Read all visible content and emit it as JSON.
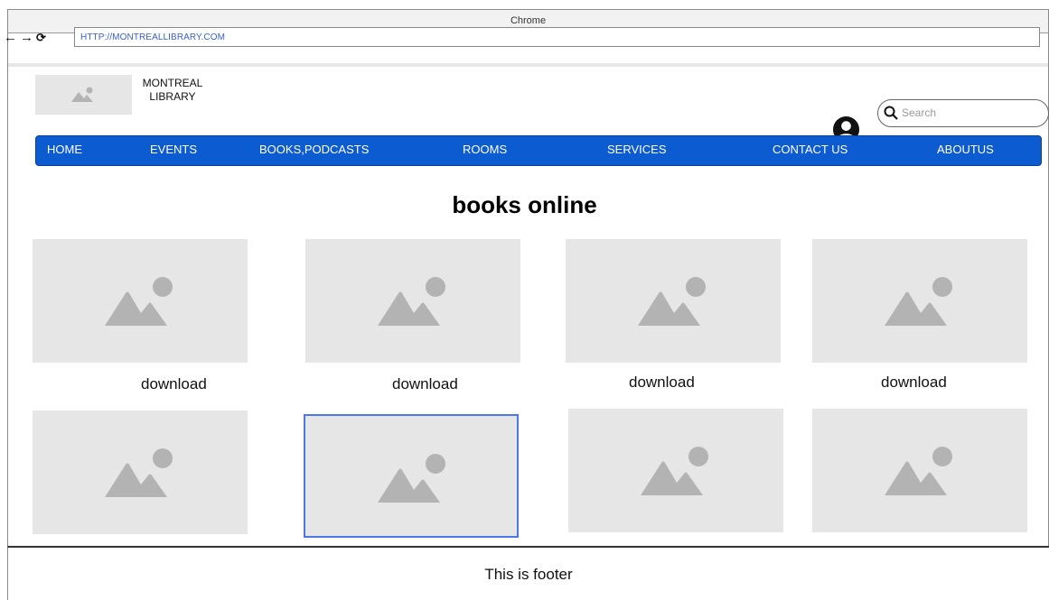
{
  "browser": {
    "title": "Chrome",
    "url": "HTTP://MONTREALLIBRARY.COM",
    "icons": [
      "back-arrow-icon",
      "forward-arrow-icon",
      "reload-icon"
    ]
  },
  "header": {
    "logo_lines": [
      "MONTREAL",
      "LIBRARY"
    ],
    "user_icon": "user-account-icon",
    "search_placeholder": "Search"
  },
  "nav": {
    "items": [
      "HOME",
      "EVENTS",
      "BOOKS,PODCASTS",
      "ROOMS",
      "SERVICES",
      "CONTACT US",
      "ABOUTUS"
    ]
  },
  "main": {
    "title": "books online",
    "row1": [
      {
        "label": "download"
      },
      {
        "label": "download"
      },
      {
        "label": "download"
      },
      {
        "label": "download"
      }
    ]
  },
  "footer": {
    "text": "This is footer"
  },
  "colors": {
    "nav_bg": "#0d5bd1",
    "placeholder_bg": "#e6e6e6",
    "placeholder_icon": "#b3b3b3",
    "selected_border": "#4a78e6",
    "url_text": "#3a5fcd"
  }
}
